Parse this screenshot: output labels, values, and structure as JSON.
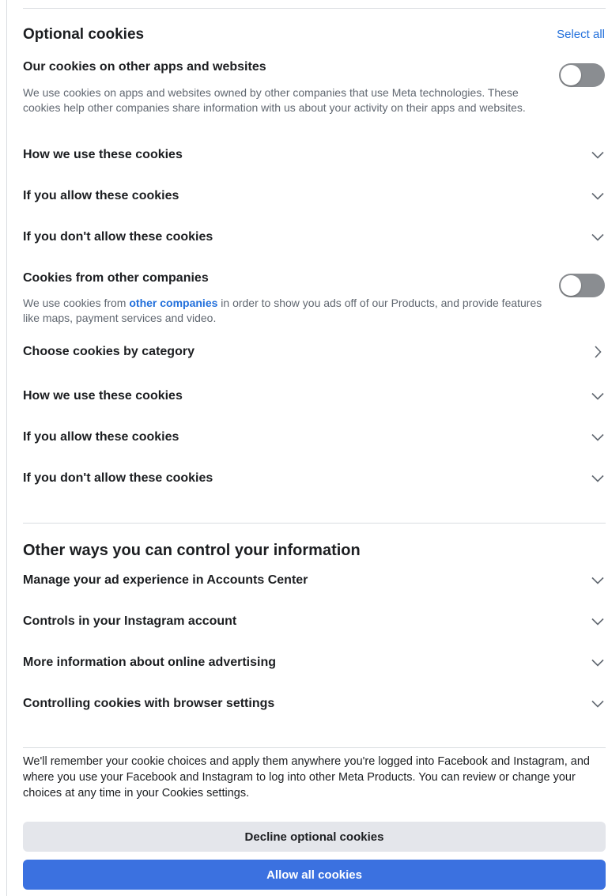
{
  "optional": {
    "title": "Optional cookies",
    "select_all": "Select all",
    "other_apps": {
      "title": "Our cookies on other apps and websites",
      "description": "We use cookies on apps and websites owned by other companies that use Meta technologies. These cookies help other companies share information with us about your activity on their apps and websites.",
      "toggle_on": false,
      "rows": [
        "How we use these cookies",
        "If you allow these cookies",
        "If you don't allow these cookies"
      ]
    },
    "other_companies": {
      "title": "Cookies from other companies",
      "desc_prefix": "We use cookies from ",
      "desc_link": "other companies",
      "desc_suffix": " in order to show you ads off of our Products, and provide features like maps, payment services and video.",
      "toggle_on": false,
      "category_row": "Choose cookies by category",
      "rows": [
        "How we use these cookies",
        "If you allow these cookies",
        "If you don't allow these cookies"
      ]
    }
  },
  "other_ways": {
    "title": "Other ways you can control your information",
    "rows": [
      "Manage your ad experience in Accounts Center",
      "Controls in your Instagram account",
      "More information about online advertising",
      "Controlling cookies with browser settings"
    ]
  },
  "footer": {
    "text": "We'll remember your cookie choices and apply them anywhere you're logged into Facebook and Instagram, and where you use your Facebook and Instagram to log into other Meta Products. You can review or change your choices at any time in your Cookies settings.",
    "decline_label": "Decline optional cookies",
    "allow_label": "Allow all cookies"
  },
  "icons": {
    "chevron_down": "chevron-down-icon",
    "chevron_right": "chevron-right-icon"
  },
  "colors": {
    "link": "#216fdb",
    "primary_button": "#3b71e0",
    "secondary_button": "#e4e6eb",
    "toggle_off": "#8a8d91"
  }
}
